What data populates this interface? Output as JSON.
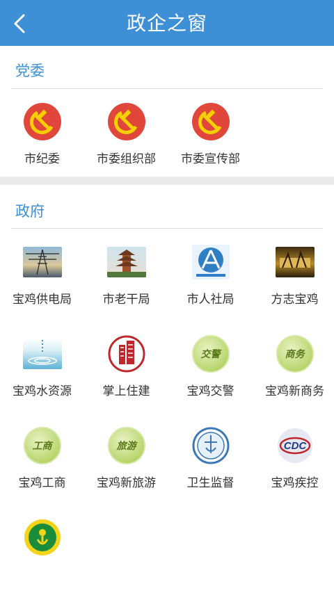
{
  "header": {
    "title": "政企之窗"
  },
  "sections": {
    "party": {
      "title": "党委",
      "items": [
        {
          "label": "市纪委",
          "icon": "party-emblem-icon"
        },
        {
          "label": "市委组织部",
          "icon": "party-emblem-icon"
        },
        {
          "label": "市委宣传部",
          "icon": "party-emblem-icon"
        }
      ]
    },
    "government": {
      "title": "政府",
      "items": [
        {
          "label": "宝鸡供电局",
          "icon": "power-tower-photo-icon"
        },
        {
          "label": "市老干局",
          "icon": "pavilion-photo-icon"
        },
        {
          "label": "市人社局",
          "icon": "human-resources-logo-icon"
        },
        {
          "label": "方志宝鸡",
          "icon": "fangzhi-photo-icon"
        },
        {
          "label": "宝鸡水资源",
          "icon": "water-drop-photo-icon"
        },
        {
          "label": "掌上住建",
          "icon": "building-logo-icon"
        },
        {
          "label": "宝鸡交警",
          "icon": "traffic-police-badge-icon",
          "badge_text": "交警"
        },
        {
          "label": "宝鸡新商务",
          "icon": "commerce-badge-icon",
          "badge_text": "商务"
        },
        {
          "label": "宝鸡工商",
          "icon": "industry-commerce-badge-icon",
          "badge_text": "工商"
        },
        {
          "label": "宝鸡新旅游",
          "icon": "tourism-badge-icon",
          "badge_text": "旅游"
        },
        {
          "label": "卫生监督",
          "icon": "health-supervision-seal-icon"
        },
        {
          "label": "宝鸡疾控",
          "icon": "cdc-logo-icon",
          "badge_text": "CDC"
        },
        {
          "label": "",
          "icon": "disabled-federation-logo-icon"
        }
      ]
    }
  },
  "colors": {
    "header_bg": "#3d8fd6",
    "section_title": "#3d8fd6",
    "party_red": "#e0463a",
    "party_gold": "#f5d000"
  }
}
